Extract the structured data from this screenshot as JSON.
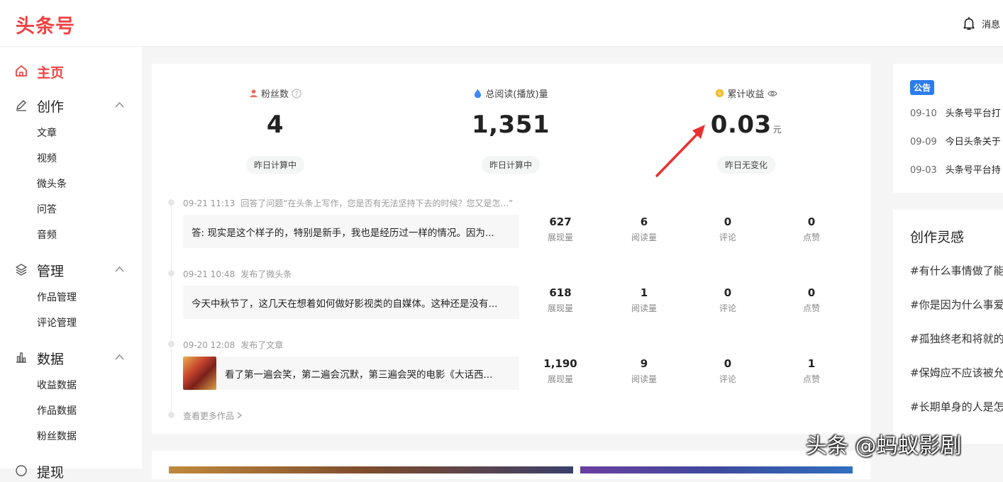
{
  "app": {
    "logo": "头条号",
    "messages_label": "消息"
  },
  "sidebar": {
    "home": "主页",
    "create": {
      "label": "创作",
      "items": [
        "文章",
        "视频",
        "微头条",
        "问答",
        "音频"
      ]
    },
    "manage": {
      "label": "管理",
      "items": [
        "作品管理",
        "评论管理"
      ]
    },
    "data": {
      "label": "数据",
      "items": [
        "收益数据",
        "作品数据",
        "粉丝数据"
      ]
    },
    "next": "提现"
  },
  "stats": [
    {
      "label": "粉丝数",
      "value": "4",
      "unit": "",
      "badge": "昨日计算中",
      "icon": "person-icon"
    },
    {
      "label": "总阅读(播放)量",
      "value": "1,351",
      "unit": "",
      "badge": "昨日计算中",
      "icon": "drop-icon"
    },
    {
      "label": "累计收益",
      "value": "0.03",
      "unit": "元",
      "badge": "昨日无变化",
      "icon": "coin-icon"
    }
  ],
  "feed": [
    {
      "time": "09-21 11:13",
      "action": "回答了问题",
      "title": "“在头条上写作，您是否有无法坚持下去的时候？您又是怎...”",
      "text": "答: 现实是这个样子的，特别是新手，我也是经历过一样的情况。因为...",
      "metrics": {
        "impressions": "627",
        "reads": "6",
        "comments": "0",
        "likes": "0"
      }
    },
    {
      "time": "09-21 10:48",
      "action": "发布了微头条",
      "title": "",
      "text": "今天中秋节了，这几天在想着如何做好影视类的自媒体。这种还是没有...",
      "metrics": {
        "impressions": "618",
        "reads": "1",
        "comments": "0",
        "likes": "0"
      }
    },
    {
      "time": "09-20 12:08",
      "action": "发布了文章",
      "title": "",
      "text": "看了第一遍会笑，第二遍会沉默，第三遍会哭的电影《大话西...",
      "metrics": {
        "impressions": "1,190",
        "reads": "9",
        "comments": "0",
        "likes": "1"
      }
    }
  ],
  "metric_labels": {
    "impressions": "展现量",
    "reads": "阅读量",
    "comments": "评论",
    "likes": "点赞"
  },
  "more_label": "查看更多作品",
  "notice": {
    "tag": "公告",
    "items": [
      {
        "date": "09-10",
        "text": "头条号平台打"
      },
      {
        "date": "09-09",
        "text": "今日头条关于"
      },
      {
        "date": "09-03",
        "text": "头条号平台持"
      }
    ]
  },
  "inspiration": {
    "title": "创作灵感",
    "items": [
      "#有什么事情做了能",
      "#你是因为什么事爱",
      "#孤独终老和将就的",
      "#保姆应不应该被允",
      "#长期单身的人是怎"
    ]
  },
  "watermark": "头条 @蚂蚁影剧",
  "colors": {
    "brand": "#f04142",
    "notice": "#2b7cf0",
    "arrow": "#e8312f"
  }
}
